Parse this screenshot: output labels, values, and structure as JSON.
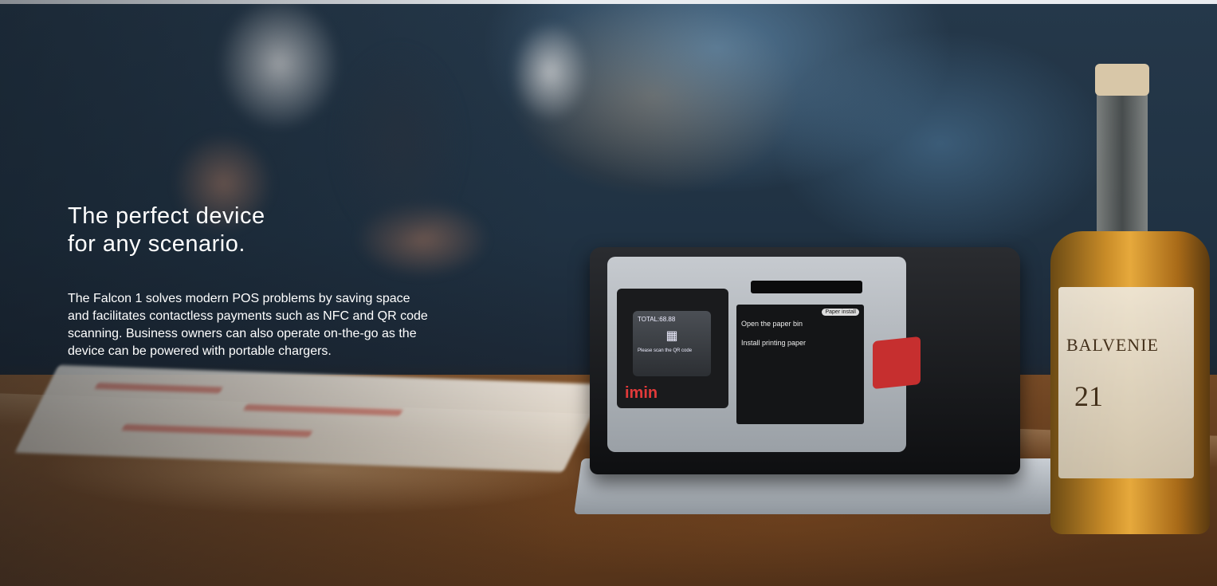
{
  "hero": {
    "title_line1": "The perfect device",
    "title_line2": "for any scenario.",
    "body": "The Falcon 1 solves modern POS problems by saving space and facilitates contactless payments such as NFC and QR code scanning. Business owners can also operate on-the-go as the device can be powered with portable chargers."
  },
  "device": {
    "brand": "imin",
    "screen_total": "TOTAL:68.88",
    "screen_hint": "Please scan the QR code",
    "sticker_step1": "Open the paper bin",
    "sticker_step2": "Install printing paper",
    "sticker_badge": "Paper install"
  },
  "bottle": {
    "label": "BALVENIE",
    "age": "21"
  },
  "colors": {
    "accent_red": "#c62f2f",
    "text_white": "#ffffff"
  }
}
